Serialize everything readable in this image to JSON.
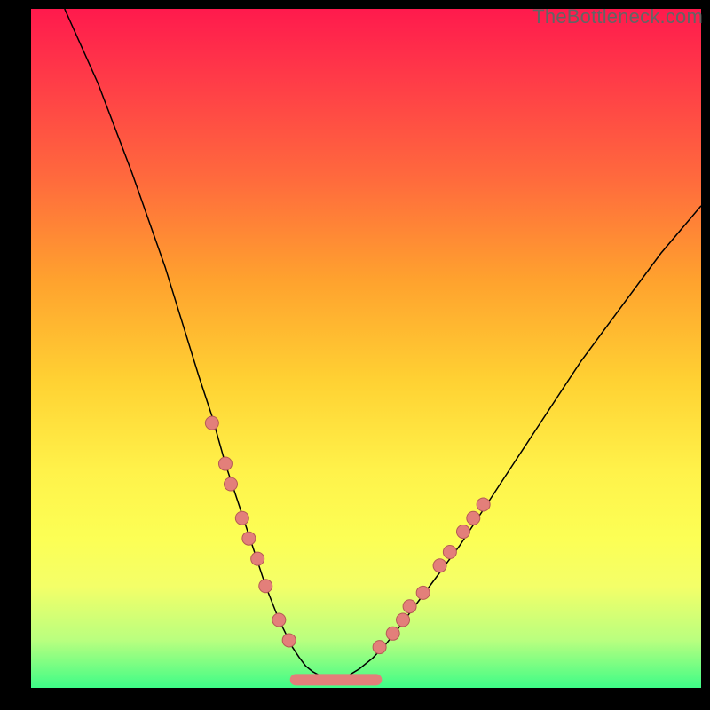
{
  "watermark": "TheBottleneck.com",
  "chart_data": {
    "type": "line",
    "title": "",
    "xlabel": "",
    "ylabel": "",
    "xlim": [
      0,
      100
    ],
    "ylim": [
      0,
      100
    ],
    "series": [
      {
        "name": "curve",
        "x": [
          5,
          10,
          15,
          20,
          25,
          27,
          29,
          31,
          33,
          35,
          37,
          38,
          39,
          40,
          41,
          42,
          43.5,
          45,
          47,
          49,
          51,
          53,
          55,
          58,
          61,
          64,
          68,
          72,
          76,
          82,
          88,
          94,
          100
        ],
        "values": [
          100,
          89,
          76,
          62,
          46,
          40,
          33,
          27,
          21,
          15,
          10,
          8,
          6,
          4.5,
          3.2,
          2.4,
          1.6,
          1.2,
          1.6,
          2.8,
          4.4,
          6.5,
          9.0,
          13,
          17,
          21,
          27,
          33,
          39,
          48,
          56,
          64,
          71
        ]
      }
    ],
    "dots_left": [
      {
        "x": 27.0,
        "y": 39
      },
      {
        "x": 29.0,
        "y": 33
      },
      {
        "x": 29.8,
        "y": 30
      },
      {
        "x": 31.5,
        "y": 25
      },
      {
        "x": 32.5,
        "y": 22
      },
      {
        "x": 33.8,
        "y": 19
      },
      {
        "x": 35.0,
        "y": 15
      },
      {
        "x": 37.0,
        "y": 10
      },
      {
        "x": 38.5,
        "y": 7
      }
    ],
    "dots_right": [
      {
        "x": 52.0,
        "y": 6
      },
      {
        "x": 54.0,
        "y": 8
      },
      {
        "x": 55.5,
        "y": 10
      },
      {
        "x": 56.5,
        "y": 12
      },
      {
        "x": 58.5,
        "y": 14
      },
      {
        "x": 61.0,
        "y": 18
      },
      {
        "x": 62.5,
        "y": 20
      },
      {
        "x": 64.5,
        "y": 23
      },
      {
        "x": 66.0,
        "y": 25
      },
      {
        "x": 67.5,
        "y": 27
      }
    ],
    "bottom_segment": {
      "x_start": 39.5,
      "x_end": 51.5,
      "y": 1.2
    },
    "gradient_stops": [
      {
        "pos": 0,
        "color": "#ff1a4d"
      },
      {
        "pos": 55,
        "color": "#ffd233"
      },
      {
        "pos": 100,
        "color": "#3efc87"
      }
    ]
  }
}
